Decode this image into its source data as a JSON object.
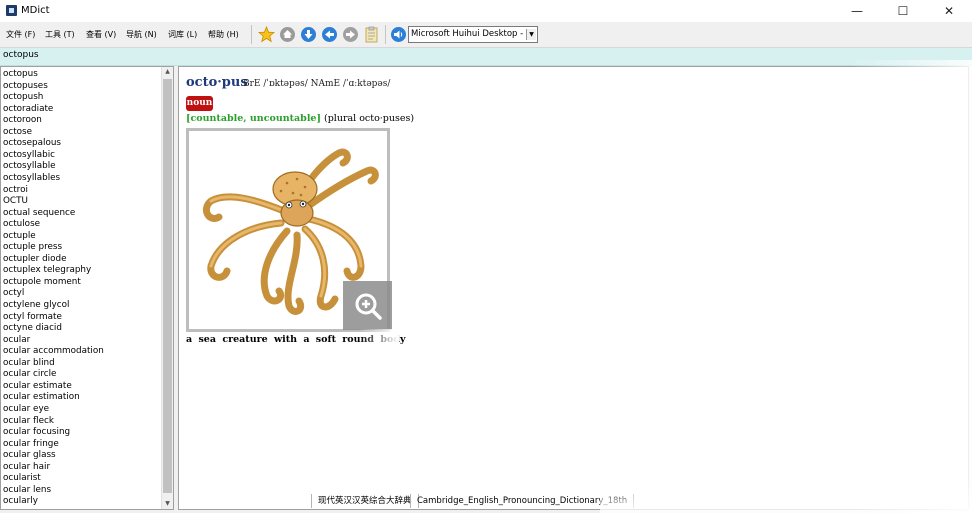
{
  "window": {
    "title": "MDict",
    "minimize_glyph": "—",
    "maximize_glyph": "☐",
    "close_glyph": "✕"
  },
  "menu": {
    "items": [
      "文件 (F)",
      "工具 (T)",
      "查看 (V)",
      "导航 (N)",
      "词库 (L)",
      "帮助 (H)"
    ]
  },
  "toolbar": {
    "icons": [
      "favorite-star-icon",
      "home-icon",
      "forward-icon",
      "back-icon",
      "history-icon",
      "clipboard-icon",
      "speaker-icon"
    ],
    "voice_select": "Microsoft Huihui Desktop - C",
    "dropdown_glyph": "▼"
  },
  "search": {
    "value": "octopus"
  },
  "wordlist": {
    "items": [
      "octopus",
      "octopuses",
      "octopush",
      "octoradiate",
      "octoroon",
      "octose",
      "octosepalous",
      "octosyllabic",
      "octosyllable",
      "octosyllables",
      "octroi",
      "OCTU",
      "octual sequence",
      "octulose",
      "octuple",
      "octuple press",
      "octupler diode",
      "octuplex telegraphy",
      "octupole moment",
      "octyl",
      "octylene glycol",
      "octyl formate",
      "octyne diacid",
      "ocular",
      "ocular accommodation",
      "ocular blind",
      "ocular circle",
      "ocular estimate",
      "ocular estimation",
      "ocular eye",
      "ocular fleck",
      "ocular focusing",
      "ocular fringe",
      "ocular glass",
      "ocular hair",
      "ocularist",
      "ocular lens",
      "ocularly"
    ],
    "scroll_up_glyph": "▲",
    "scroll_down_glyph": "▼"
  },
  "entry": {
    "headword": "octo·pus",
    "pronunciation": "BrE /ˈɒktəpəs/   NAmE /ˈɑːktəpəs/",
    "part_of_speech": "noun",
    "grammar_code": "[countable, uncountable]",
    "grammar_note": "(plural octo·puses)",
    "picture": "octopus-illustration",
    "definition": "a sea creature with a soft round body"
  },
  "statusbar": {
    "dictionaries": [
      "现代英汉汉英综合大辞典",
      "Cambridge_English_Pronouncing_Dictionary_18th"
    ]
  },
  "colors": {
    "headword": "#1f3a7c",
    "noun_badge": "#c01111",
    "grammar_code": "#2aa02a",
    "searchbar_bg": "#d7f1f1"
  }
}
